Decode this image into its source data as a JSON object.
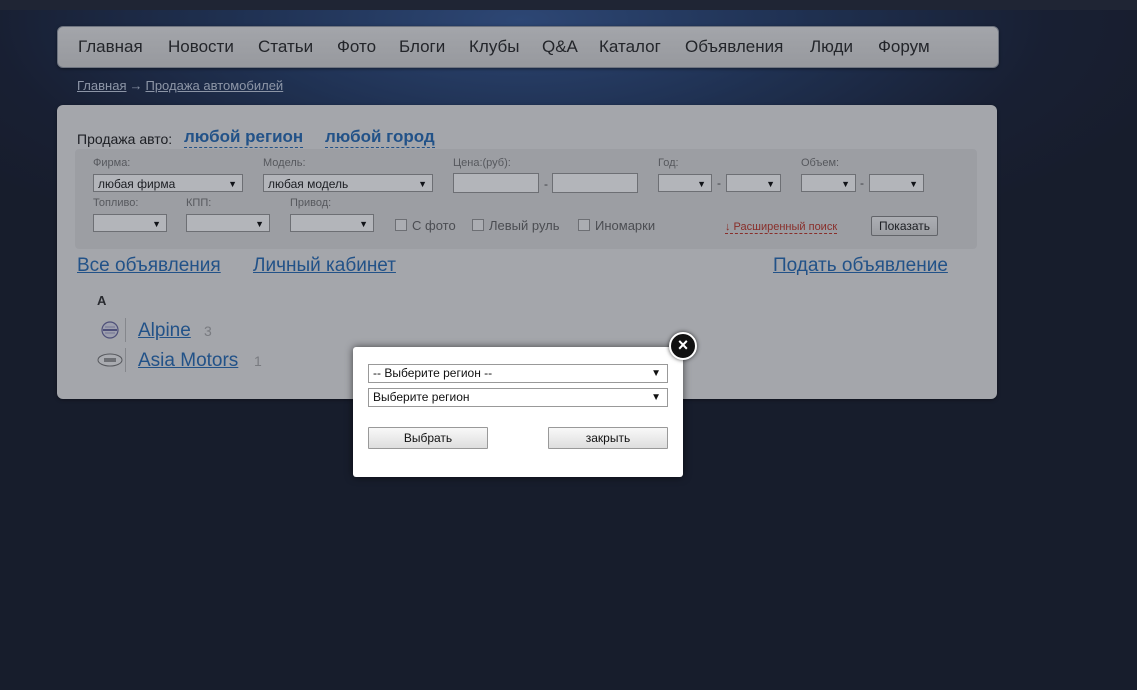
{
  "nav": {
    "items": [
      "Главная",
      "Новости",
      "Статьи",
      "Фото",
      "Блоги",
      "Клубы",
      "Q&A",
      "Каталог",
      "Объявления",
      "Люди",
      "Форум"
    ]
  },
  "breadcrumb": {
    "home": "Главная",
    "arrow": "→",
    "current": "Продажа автомобилей"
  },
  "filter": {
    "sale_label": "Продажа авто:",
    "region_link": "любой регион",
    "city_link": "любой город",
    "firm_label": "Фирма:",
    "firm_value": "любая фирма",
    "model_label": "Модель:",
    "model_value": "любая модель",
    "price_label": "Цена:(руб):",
    "year_label": "Год:",
    "volume_label": "Объем:",
    "fuel_label": "Топливо:",
    "gearbox_label": "КПП:",
    "drive_label": "Привод:",
    "range_dash": "-",
    "with_photo": "С фото",
    "left_wheel": "Левый руль",
    "foreign": "Иномарки",
    "advanced_search": "↓ Расширенный поиск",
    "show_button": "Показать"
  },
  "links": {
    "all_ads": "Все объявления",
    "cabinet": "Личный кабинет",
    "post_ad": "Подать объявление"
  },
  "brands": {
    "letter": "A",
    "items": [
      {
        "name": "Alpine",
        "count": "3"
      },
      {
        "name": "Asia Motors",
        "count": "1"
      }
    ]
  },
  "modal": {
    "select_region_1": "-- Выберите регион --",
    "select_region_2": "Выберите регион",
    "choose_button": "Выбрать",
    "close_button": "закрыть",
    "close_icon": "×"
  }
}
